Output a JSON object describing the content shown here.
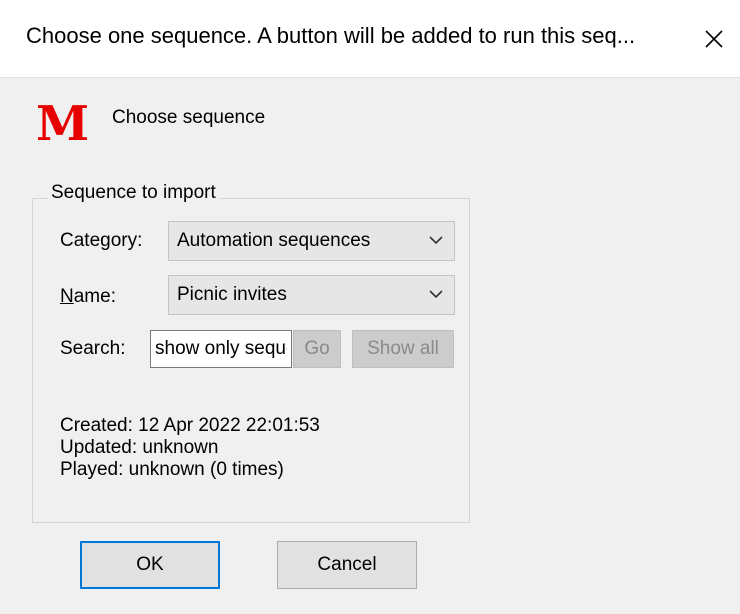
{
  "window": {
    "title": "Choose one sequence. A button will be added to run this seq..."
  },
  "header": {
    "logo_letter": "M",
    "text": "Choose sequence"
  },
  "group": {
    "legend": "Sequence to import",
    "category": {
      "label": "Category:",
      "value": "Automation sequences"
    },
    "name": {
      "label_underlined": "N",
      "label_rest": "ame:",
      "value": "Picnic invites"
    },
    "search": {
      "label": "Search:",
      "placeholder": "show only sequences",
      "go_label": "Go",
      "show_all_label": "Show all"
    },
    "info": {
      "created": "Created: 12 Apr 2022 22:01:53",
      "updated": "Updated: unknown",
      "played": "Played: unknown (0 times)"
    }
  },
  "buttons": {
    "ok": "OK",
    "cancel": "Cancel"
  },
  "colors": {
    "logo": "#e60000",
    "default_button_border": "#0078d7"
  },
  "icons": {
    "close": "close-icon",
    "dropdown": "chevron-down-icon"
  }
}
